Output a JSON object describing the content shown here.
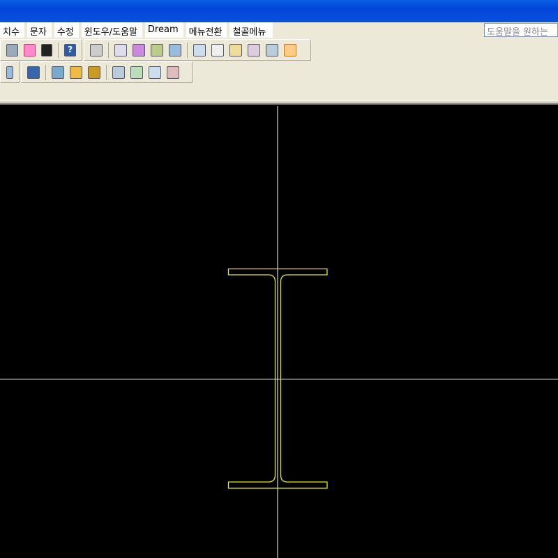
{
  "menubar": {
    "items": [
      "치수",
      "문자",
      "수정",
      "윈도우/도움말",
      "Dream",
      "메뉴전환",
      "철골메뉴"
    ]
  },
  "help_box": {
    "placeholder": "도움말을 원하는"
  },
  "toolbar1": {
    "icons": [
      "layer-tool-icon",
      "cloud-markup-icon",
      "calculator-icon",
      "help-icon",
      "clipboard-icon",
      "paste-icon",
      "tag-red-icon",
      "tag-green-icon",
      "tag-blue-icon",
      "grid-1-icon",
      "grid-2-icon",
      "grid-edit-icon",
      "grid-3-icon",
      "grid-4-icon",
      "grid-5-icon"
    ]
  },
  "toolbar2": {
    "icons": [
      "window-stack-icon",
      "overlap-icon",
      "edit-grid-icon",
      "pencil-icon",
      "pencil-curve-icon",
      "tag-edit-icon",
      "tag-circle-icon",
      "tag-arrow-icon",
      "tag-pointer-icon"
    ]
  },
  "colors": {
    "drawing": "#e8e820",
    "crosshair": "#ffffff",
    "background": "#000000",
    "titlebar": "#0a52e0"
  }
}
